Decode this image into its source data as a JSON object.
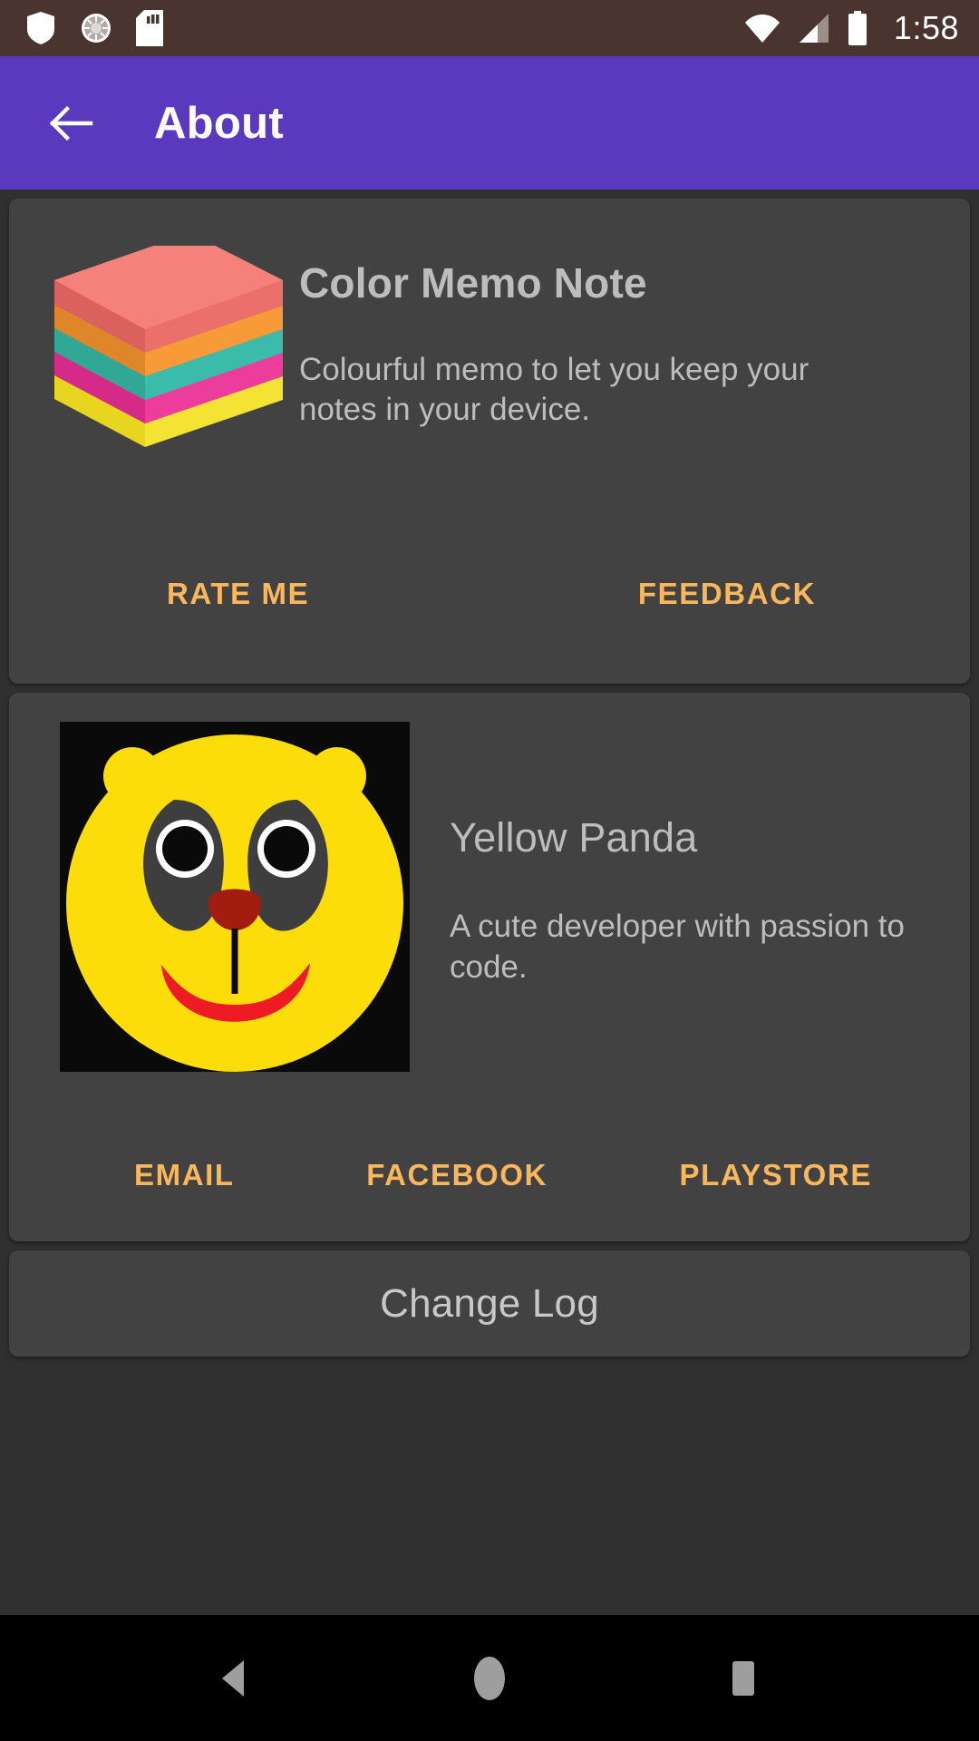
{
  "status_bar": {
    "background_color": "#4A342F",
    "time": "1:58",
    "left_icons": [
      "shield-icon",
      "compass-icon",
      "sd-card-icon"
    ],
    "right_icons": [
      "wifi-icon",
      "cellular-signal-icon",
      "battery-icon"
    ]
  },
  "app_bar": {
    "background_color": "#5B39BF",
    "back_icon": "back-arrow-icon",
    "title": "About"
  },
  "theme": {
    "page_background": "#303030",
    "card_background": "#424242",
    "accent_color": "#FBB75B",
    "primary_text": "#BDBDBD",
    "nav_background": "#000000"
  },
  "app_card": {
    "icon": "color-memo-note-stack-icon",
    "icon_colors": {
      "top": "#F2746E",
      "layer1": "#FB9B33",
      "layer2": "#3DBFAC",
      "layer3": "#F0359B",
      "layer4": "#F7E52C"
    },
    "name": "Color Memo Note",
    "description": "Colourful memo to let you keep your notes in your device.",
    "buttons": [
      {
        "label": "RATE ME",
        "name": "rate-me-button"
      },
      {
        "label": "FEEDBACK",
        "name": "feedback-button"
      }
    ]
  },
  "developer_card": {
    "avatar": "yellow-panda-avatar",
    "avatar_colors": {
      "background": "#0A0A0A",
      "face": "#FCDD09",
      "eye_patch": "#3E3E3E",
      "nose": "#A31C10",
      "mouth": "#EE1B24"
    },
    "name": "Yellow Panda",
    "description": "A cute developer with passion to code.",
    "buttons": [
      {
        "label": "EMAIL",
        "name": "email-button"
      },
      {
        "label": "FACEBOOK",
        "name": "facebook-button"
      },
      {
        "label": "PLAYSTORE",
        "name": "playstore-button"
      }
    ]
  },
  "change_log": {
    "label": "Change Log"
  },
  "nav_bar": {
    "buttons": [
      {
        "name": "nav-back-button",
        "icon": "triangle-back-icon"
      },
      {
        "name": "nav-home-button",
        "icon": "circle-home-icon"
      },
      {
        "name": "nav-recents-button",
        "icon": "square-recents-icon"
      }
    ]
  }
}
